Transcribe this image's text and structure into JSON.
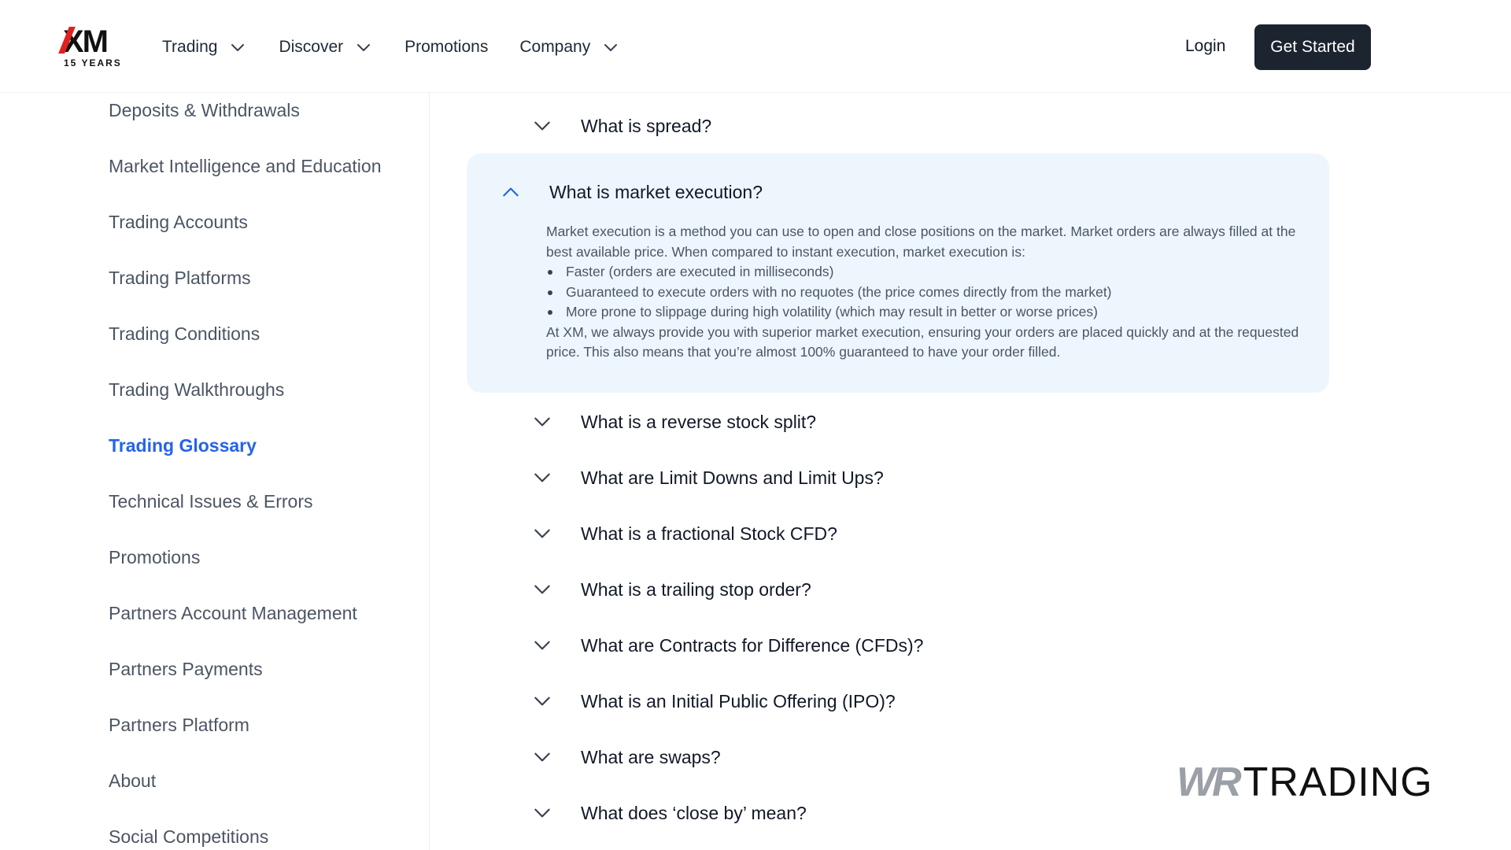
{
  "header": {
    "logo": {
      "mark": "XM",
      "tagline": "15 YEARS"
    },
    "nav": [
      {
        "label": "Trading",
        "has_dropdown": true
      },
      {
        "label": "Discover",
        "has_dropdown": true
      },
      {
        "label": "Promotions",
        "has_dropdown": false
      },
      {
        "label": "Company",
        "has_dropdown": true
      }
    ],
    "login_label": "Login",
    "cta_label": "Get Started"
  },
  "sidebar": {
    "items": [
      {
        "label": "Deposits & Withdrawals",
        "active": false
      },
      {
        "label": "Market Intelligence and Education",
        "active": false
      },
      {
        "label": "Trading Accounts",
        "active": false
      },
      {
        "label": "Trading Platforms",
        "active": false
      },
      {
        "label": "Trading Conditions",
        "active": false
      },
      {
        "label": "Trading Walkthroughs",
        "active": false
      },
      {
        "label": "Trading Glossary",
        "active": true
      },
      {
        "label": "Technical Issues & Errors",
        "active": false
      },
      {
        "label": "Promotions",
        "active": false
      },
      {
        "label": "Partners Account Management",
        "active": false
      },
      {
        "label": "Partners Payments",
        "active": false
      },
      {
        "label": "Partners Platform",
        "active": false
      },
      {
        "label": "About",
        "active": false
      },
      {
        "label": "Social Competitions",
        "active": false
      }
    ]
  },
  "faq": {
    "items": [
      {
        "question": "What is spread?",
        "expanded": false
      },
      {
        "question": "What is market execution?",
        "expanded": true
      },
      {
        "question": "What is a reverse stock split?",
        "expanded": false
      },
      {
        "question": "What are Limit Downs and Limit Ups?",
        "expanded": false
      },
      {
        "question": "What is a fractional Stock CFD?",
        "expanded": false
      },
      {
        "question": "What is a trailing stop order?",
        "expanded": false
      },
      {
        "question": "What are Contracts for Difference (CFDs)?",
        "expanded": false
      },
      {
        "question": "What is an Initial Public Offering (IPO)?",
        "expanded": false
      },
      {
        "question": "What are swaps?",
        "expanded": false
      },
      {
        "question": "What does ‘close by’ mean?",
        "expanded": false
      }
    ],
    "answer": {
      "intro": "Market execution is a method you can use to open and close positions on the market. Market orders are always filled at the best available price. When compared to instant execution, market execution is:",
      "bullets": [
        "Faster (orders are executed in milliseconds)",
        "Guaranteed to execute orders with no requotes (the price comes directly from the market)",
        "More prone to slippage during high volatility (which may result in better or worse prices)"
      ],
      "outro": "At XM, we always provide you with superior market execution, ensuring your orders are placed quickly and at the requested price. This also means that you’re almost 100% guaranteed to have your order filled."
    }
  },
  "watermark": {
    "prefix": "WR",
    "text": "TRADING"
  },
  "colors": {
    "accent": "#2563eb",
    "cta_bg": "#1c2430",
    "expanded_bg": "#eef6fd",
    "logo_red": "#e02020"
  }
}
